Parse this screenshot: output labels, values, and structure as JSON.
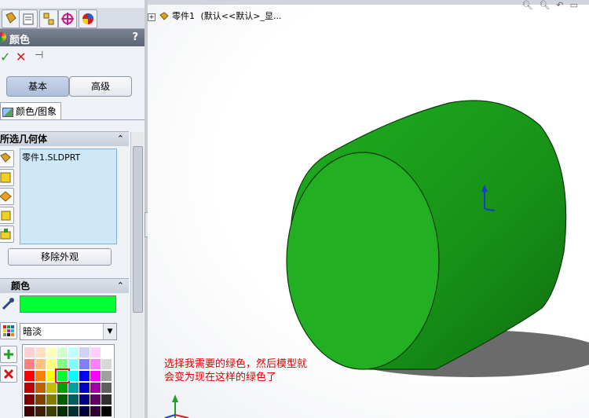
{
  "feature_tree": {
    "part_label": "零件1",
    "config_label": "(默认<<默认>_显..."
  },
  "panel": {
    "title": "颜色",
    "help": "?",
    "mode_tabs": {
      "basic": "基本",
      "advanced": "高级"
    },
    "subtab": "颜色/图象",
    "geometry_section": {
      "title": "所选几何体",
      "selected_items": [
        "零件1.SLDPRT"
      ],
      "remove_button": "移除外观"
    },
    "color_section": {
      "title": "颜色",
      "current_color": "#00ff33",
      "palette_dropdown": "暗淡"
    }
  },
  "annotation": {
    "line1": "选择我需要的绿色，然后模型就",
    "line2": "会变为现在这样的绿色了"
  },
  "colors": {
    "model_green": "#22b022",
    "caption_red": "#e00000",
    "accent_header": "#6a7383"
  }
}
